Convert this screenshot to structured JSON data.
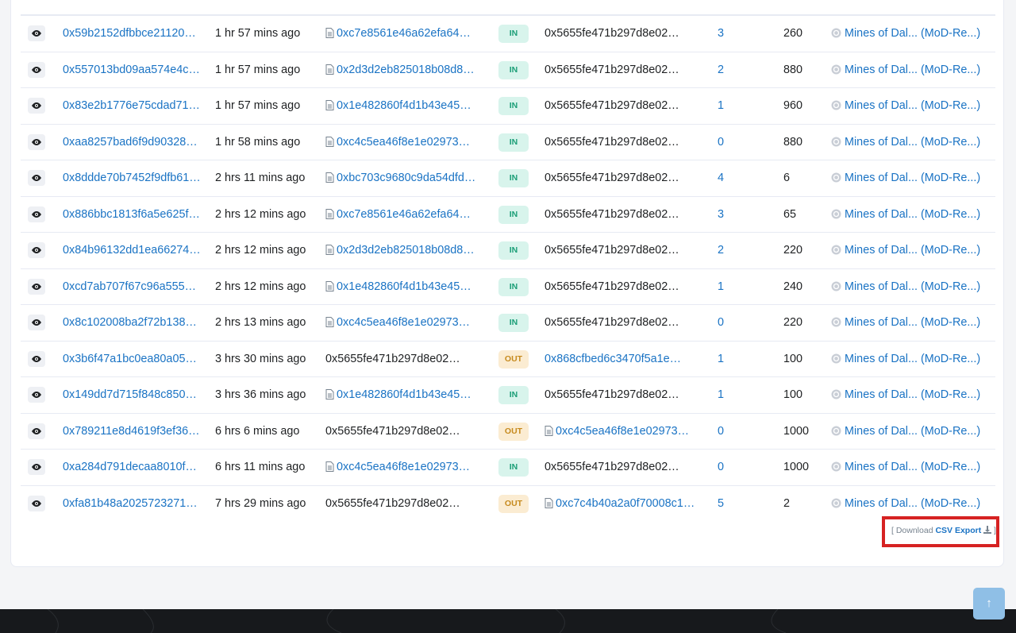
{
  "colors": {
    "link": "#1a73c4",
    "in_badge_bg": "#d8f4ec",
    "out_badge_bg": "#fbecd2",
    "highlight": "#d62222"
  },
  "rows": [
    {
      "hash": "0x59b2152dfbbce21120…",
      "age": "1 hr 57 mins ago",
      "from": "0xc7e8561e46a62efa64…",
      "from_contract": true,
      "dir": "IN",
      "to": "0x5655fe471b297d8e02…",
      "to_link": false,
      "to_contract": false,
      "token_id": "3",
      "value": "260",
      "collection": "Mines of Dal... (MoD-Re...)"
    },
    {
      "hash": "0x557013bd09aa574e4c…",
      "age": "1 hr 57 mins ago",
      "from": "0x2d3d2eb825018b08d8…",
      "from_contract": true,
      "dir": "IN",
      "to": "0x5655fe471b297d8e02…",
      "to_link": false,
      "to_contract": false,
      "token_id": "2",
      "value": "880",
      "collection": "Mines of Dal... (MoD-Re...)"
    },
    {
      "hash": "0x83e2b1776e75cdad71…",
      "age": "1 hr 57 mins ago",
      "from": "0x1e482860f4d1b43e45…",
      "from_contract": true,
      "dir": "IN",
      "to": "0x5655fe471b297d8e02…",
      "to_link": false,
      "to_contract": false,
      "token_id": "1",
      "value": "960",
      "collection": "Mines of Dal... (MoD-Re...)"
    },
    {
      "hash": "0xaa8257bad6f9d90328…",
      "age": "1 hr 58 mins ago",
      "from": "0xc4c5ea46f8e1e02973…",
      "from_contract": true,
      "dir": "IN",
      "to": "0x5655fe471b297d8e02…",
      "to_link": false,
      "to_contract": false,
      "token_id": "0",
      "value": "880",
      "collection": "Mines of Dal... (MoD-Re...)"
    },
    {
      "hash": "0x8ddde70b7452f9dfb61…",
      "age": "2 hrs 11 mins ago",
      "from": "0xbc703c9680c9da54dfd…",
      "from_contract": true,
      "dir": "IN",
      "to": "0x5655fe471b297d8e02…",
      "to_link": false,
      "to_contract": false,
      "token_id": "4",
      "value": "6",
      "collection": "Mines of Dal... (MoD-Re...)"
    },
    {
      "hash": "0x886bbc1813f6a5e625f…",
      "age": "2 hrs 12 mins ago",
      "from": "0xc7e8561e46a62efa64…",
      "from_contract": true,
      "dir": "IN",
      "to": "0x5655fe471b297d8e02…",
      "to_link": false,
      "to_contract": false,
      "token_id": "3",
      "value": "65",
      "collection": "Mines of Dal... (MoD-Re...)"
    },
    {
      "hash": "0x84b96132dd1ea66274…",
      "age": "2 hrs 12 mins ago",
      "from": "0x2d3d2eb825018b08d8…",
      "from_contract": true,
      "dir": "IN",
      "to": "0x5655fe471b297d8e02…",
      "to_link": false,
      "to_contract": false,
      "token_id": "2",
      "value": "220",
      "collection": "Mines of Dal... (MoD-Re...)"
    },
    {
      "hash": "0xcd7ab707f67c96a555…",
      "age": "2 hrs 12 mins ago",
      "from": "0x1e482860f4d1b43e45…",
      "from_contract": true,
      "dir": "IN",
      "to": "0x5655fe471b297d8e02…",
      "to_link": false,
      "to_contract": false,
      "token_id": "1",
      "value": "240",
      "collection": "Mines of Dal... (MoD-Re...)"
    },
    {
      "hash": "0x8c102008ba2f72b138…",
      "age": "2 hrs 13 mins ago",
      "from": "0xc4c5ea46f8e1e02973…",
      "from_contract": true,
      "dir": "IN",
      "to": "0x5655fe471b297d8e02…",
      "to_link": false,
      "to_contract": false,
      "token_id": "0",
      "value": "220",
      "collection": "Mines of Dal... (MoD-Re...)"
    },
    {
      "hash": "0x3b6f47a1bc0ea80a05…",
      "age": "3 hrs 30 mins ago",
      "from": "0x5655fe471b297d8e02…",
      "from_contract": false,
      "dir": "OUT",
      "to": "0x868cfbed6c3470f5a1e…",
      "to_link": true,
      "to_contract": false,
      "token_id": "1",
      "value": "100",
      "collection": "Mines of Dal... (MoD-Re...)"
    },
    {
      "hash": "0x149dd7d715f848c850…",
      "age": "3 hrs 36 mins ago",
      "from": "0x1e482860f4d1b43e45…",
      "from_contract": true,
      "dir": "IN",
      "to": "0x5655fe471b297d8e02…",
      "to_link": false,
      "to_contract": false,
      "token_id": "1",
      "value": "100",
      "collection": "Mines of Dal... (MoD-Re...)"
    },
    {
      "hash": "0x789211e8d4619f3ef36…",
      "age": "6 hrs 6 mins ago",
      "from": "0x5655fe471b297d8e02…",
      "from_contract": false,
      "dir": "OUT",
      "to": "0xc4c5ea46f8e1e02973…",
      "to_link": true,
      "to_contract": true,
      "token_id": "0",
      "value": "1000",
      "collection": "Mines of Dal... (MoD-Re...)"
    },
    {
      "hash": "0xa284d791decaa8010f…",
      "age": "6 hrs 11 mins ago",
      "from": "0xc4c5ea46f8e1e02973…",
      "from_contract": true,
      "dir": "IN",
      "to": "0x5655fe471b297d8e02…",
      "to_link": false,
      "to_contract": false,
      "token_id": "0",
      "value": "1000",
      "collection": "Mines of Dal... (MoD-Re...)"
    },
    {
      "hash": "0xfa81b48a2025723271…",
      "age": "7 hrs 29 mins ago",
      "from": "0x5655fe471b297d8e02…",
      "from_contract": false,
      "dir": "OUT",
      "to": "0xc7c4b40a2a0f70008c1…",
      "to_link": true,
      "to_contract": true,
      "token_id": "5",
      "value": "2",
      "collection": "Mines of Dal... (MoD-Re...)"
    }
  ],
  "csv": {
    "open": "[ Download ",
    "link": "CSV Export",
    "close": " ]"
  },
  "back_to_top": "↑"
}
